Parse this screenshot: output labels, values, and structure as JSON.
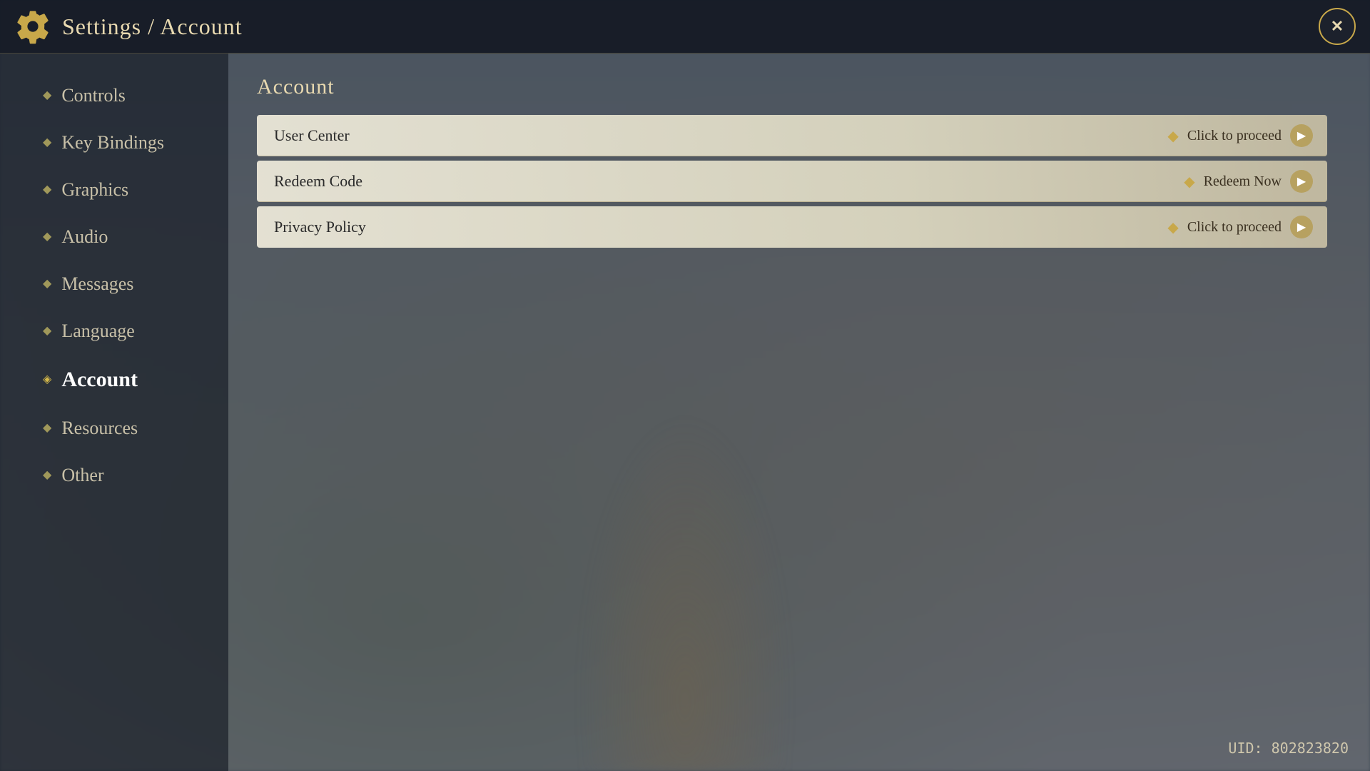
{
  "header": {
    "title": "Settings / Account",
    "close_label": "✕"
  },
  "sidebar": {
    "items": [
      {
        "id": "controls",
        "label": "Controls",
        "active": false
      },
      {
        "id": "key-bindings",
        "label": "Key Bindings",
        "active": false
      },
      {
        "id": "graphics",
        "label": "Graphics",
        "active": false
      },
      {
        "id": "audio",
        "label": "Audio",
        "active": false
      },
      {
        "id": "messages",
        "label": "Messages",
        "active": false
      },
      {
        "id": "language",
        "label": "Language",
        "active": false
      },
      {
        "id": "account",
        "label": "Account",
        "active": true
      },
      {
        "id": "resources",
        "label": "Resources",
        "active": false
      },
      {
        "id": "other",
        "label": "Other",
        "active": false
      }
    ]
  },
  "content": {
    "section_title": "Account",
    "rows": [
      {
        "id": "user-center",
        "label": "User Center",
        "action_text": "Click to proceed"
      },
      {
        "id": "redeem-code",
        "label": "Redeem Code",
        "action_text": "Redeem Now"
      },
      {
        "id": "privacy-policy",
        "label": "Privacy Policy",
        "action_text": "Click to proceed"
      }
    ]
  },
  "footer": {
    "uid": "UID: 802823820"
  },
  "icons": {
    "bullet": "◆",
    "bullet_active": "◈",
    "diamond": "◆",
    "arrow": "▶"
  }
}
